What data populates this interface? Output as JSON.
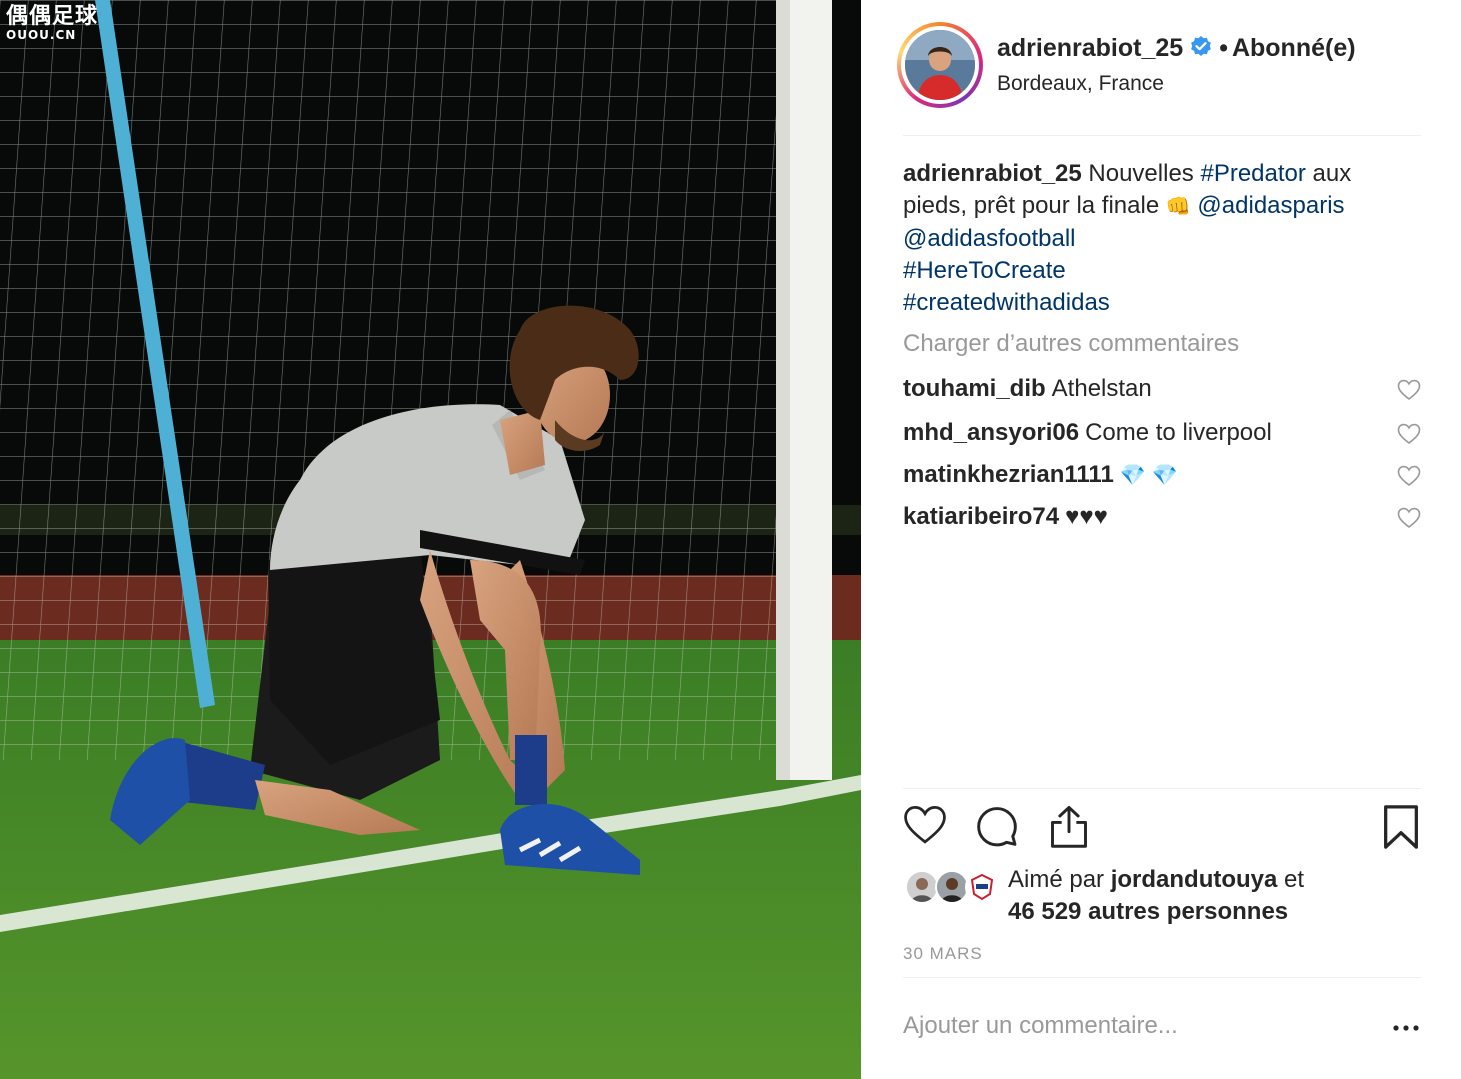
{
  "watermark": {
    "main": "偶偶足球",
    "sub": "OUOU.CN"
  },
  "post": {
    "username": "adrienrabiot_25",
    "follow_separator": "•",
    "follow_state": "Abonné(e)",
    "location": "Bordeaux, France",
    "caption": {
      "username": "adrienrabiot_25",
      "text_1": "Nouvelles ",
      "tag_predator": "#Predator",
      "text_2": " aux",
      "text_3": "pieds, prêt pour la finale",
      "emoji": "👊",
      "mention_paris": "@adidasparis",
      "mention_football": "@adidasfootball",
      "tag_create": "#HereToCreate",
      "tag_created": "#createdwithadidas"
    },
    "load_more": "Charger d’autres commentaires",
    "comments": [
      {
        "user": "touhami_dib",
        "text": "Athelstan"
      },
      {
        "user": "mhd_ansyori06",
        "text": "Come to liverpool"
      },
      {
        "user": "matinkhezrian1111",
        "text": "💎 💎"
      },
      {
        "user": "katiaribeiro74",
        "text": "♥♥♥"
      }
    ],
    "likes": {
      "prefix": "Aimé par ",
      "user": "jordandutouya",
      "suffix": " et",
      "count_text": "46 529 autres personnes"
    },
    "date": "30 MARS",
    "comment_placeholder": "Ajouter un commentaire...",
    "icons": {
      "like": "heart-outline-icon",
      "comment": "speech-bubble-icon",
      "share": "share-upload-icon",
      "save": "bookmark-icon",
      "verified": "verified-badge-icon",
      "more": "more-options-icon"
    },
    "colors": {
      "link": "#003569",
      "muted": "#999999",
      "verified": "#3897f0",
      "divider": "#efefef"
    }
  }
}
